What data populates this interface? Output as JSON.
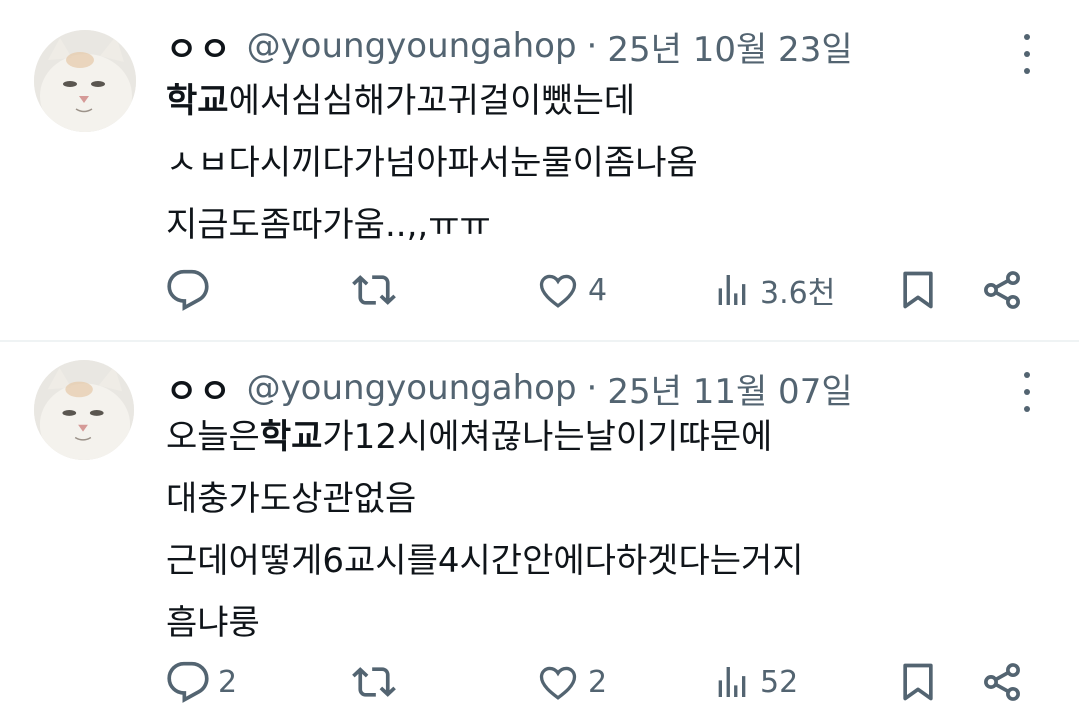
{
  "tweets": [
    {
      "display_name": "ㅇㅇ",
      "handle": "@youngyoungahop",
      "separator": "·",
      "date": "25년 10월 23일",
      "body_lines": [
        {
          "bold": "학교",
          "text": "에서심심해가꼬귀걸이뺐는데"
        },
        {
          "bold": "",
          "text": "ㅅㅂ다시끼다가넘아파서눈물이좀나옴"
        },
        {
          "bold": "",
          "text": "지금도좀따가움..,,ㅠㅠ"
        }
      ],
      "reply_count": "",
      "repost_count": "",
      "like_count": "4",
      "view_count": "3.6천"
    },
    {
      "display_name": "ㅇㅇ",
      "handle": "@youngyoungahop",
      "separator": "·",
      "date": "25년 11월 07일",
      "body_lines": [
        {
          "pre": "오늘은",
          "bold": "학교",
          "text": "가12시에쳐끊나는날이기땨문에"
        },
        {
          "pre": "",
          "bold": "",
          "text": "대충가도상관없음"
        },
        {
          "pre": "",
          "bold": "",
          "text": "근데어떻게6교시를4시간안에다하겟다는거지"
        },
        {
          "pre": "",
          "bold": "",
          "text": "흠냐룽"
        }
      ],
      "reply_count": "2",
      "repost_count": "",
      "like_count": "2",
      "view_count": "52"
    }
  ],
  "icons": {
    "reply": "reply-icon",
    "repost": "repost-icon",
    "like": "heart-icon",
    "views": "views-icon",
    "bookmark": "bookmark-icon",
    "share": "share-icon",
    "more": "more-icon"
  },
  "colors": {
    "text": "#0f1419",
    "secondary": "#536471",
    "divider": "#eff3f4"
  }
}
